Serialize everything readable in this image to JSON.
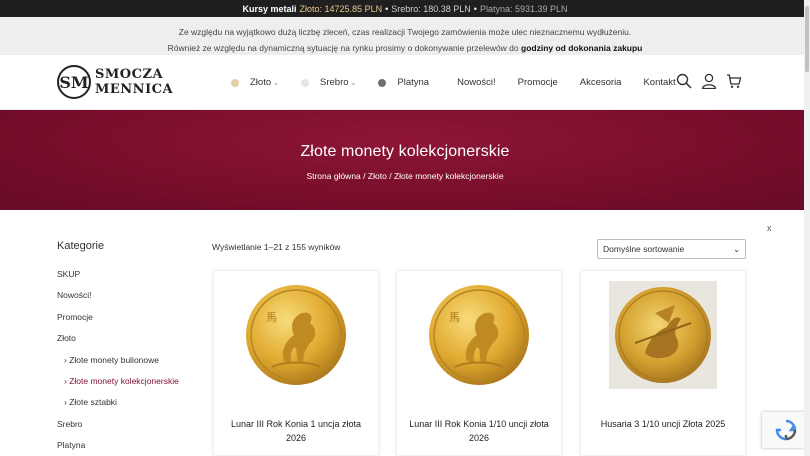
{
  "ticker": {
    "label": "Kursy metali",
    "gold": "Złoto: 14725.85 PLN",
    "silver": "Srebro: 180.38 PLN",
    "platinum": "Platyna: 5931.39 PLN",
    "sep": "•"
  },
  "notice": {
    "line1": "Ze względu na wyjątkowo dużą liczbę zleceń, czas realizacji Twojego zamówienia może ulec nieznacznemu wydłużeniu.",
    "line2_prefix": "Również ze względu na dynamiczną sytuację na rynku prosimy o dokonywanie przelewów do",
    "line2_bold": "godziny od dokonania zakupu"
  },
  "logo": {
    "mark": "SM",
    "line1": "SMOCZA",
    "line2": "MENNICA"
  },
  "nav": [
    {
      "label": "Złoto",
      "dot": "#e6cfa6",
      "dropdown": true
    },
    {
      "label": "Srebro",
      "dot": "#e4e4e4",
      "dropdown": true
    },
    {
      "label": "Platyna",
      "dot": "#6f6f6f",
      "dropdown": false
    },
    {
      "label": "Nowości!"
    },
    {
      "label": "Promocje"
    },
    {
      "label": "Akcesoria"
    },
    {
      "label": "Kontakt"
    }
  ],
  "icons": [
    "search-icon",
    "user-icon",
    "cart-icon"
  ],
  "hero": {
    "title": "Złote monety kolekcjonerskie",
    "breadcrumb": [
      "Strona główna",
      "Złoto",
      "Złote monety kolekcjonerskie"
    ],
    "sep": "/"
  },
  "sidebar": {
    "title": "Kategorie",
    "items": [
      {
        "label": "SKUP",
        "sub": false
      },
      {
        "label": "Nowości!",
        "sub": false
      },
      {
        "label": "Promocje",
        "sub": false
      },
      {
        "label": "Złoto",
        "sub": false
      },
      {
        "label": "Złote monety bulionowe",
        "sub": true
      },
      {
        "label": "Złote monety kolekcjonerskie",
        "sub": true,
        "active": true
      },
      {
        "label": "Złote sztabki",
        "sub": true
      },
      {
        "label": "Srebro",
        "sub": false
      },
      {
        "label": "Platyna",
        "sub": false
      }
    ]
  },
  "results_text": "Wyświetlanie 1–21 z 155 wyników",
  "sort": {
    "selected": "Domyślne sortowanie"
  },
  "close_label": "x",
  "products": [
    {
      "title": "Lunar III Rok Konia 1 uncja złota 2026",
      "image": "horse-gold-coin"
    },
    {
      "title": "Lunar III Rok Konia 1/10 uncji złota 2026",
      "image": "horse-gold-coin"
    },
    {
      "title": "Husaria 3 1/10 uncji Złota 2025",
      "image": "hussar-gold-coin"
    }
  ],
  "colors": {
    "brand": "#7b0f2c",
    "gold": "#d9a52e"
  }
}
